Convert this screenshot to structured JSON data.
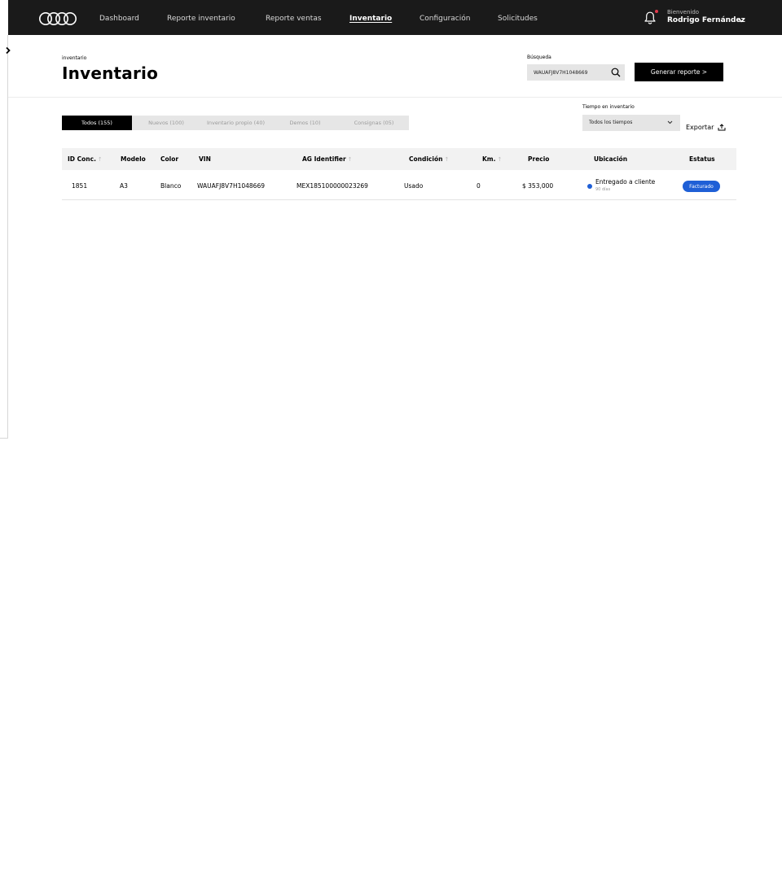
{
  "nav": {
    "items": [
      "Dashboard",
      "Reporte inventario",
      "Reporte ventas",
      "Inventario",
      "Configuración",
      "Solicitudes"
    ],
    "active": "Inventario",
    "welcome": "Bienvenido",
    "user_name": "Rodrigo Fernández"
  },
  "header": {
    "breadcrumb": "inventario",
    "title": "Inventario",
    "search_label": "Búsqueda",
    "search_value": "WAUAFJ8V7H1048669",
    "generate_button": "Generar reporte >"
  },
  "filters": {
    "tabs": [
      "Todos (155)",
      "Nuevos (100)",
      "Inventario propio (40)",
      "Demos  (10)",
      "Consignas  (05)"
    ],
    "active_tab": "Todos (155)",
    "time_label": "Tiempo en inventario",
    "time_value": "Todos los tiempos",
    "export_label": "Exportar"
  },
  "table": {
    "columns": [
      "ID Conc.",
      "Modelo",
      "Color",
      "VIN",
      "AG Identifier",
      "Condición",
      "Km.",
      "Precio",
      "Ubicación",
      "Estatus"
    ],
    "rows": [
      {
        "id": "1851",
        "modelo": "A3",
        "color": "Blanco",
        "vin": "WAUAFJ8V7H1048669",
        "ag_identifier": "MEX185100000023269",
        "condicion": "Usado",
        "km": "0",
        "precio": "$ 353,000",
        "ubicacion": "Entregado a cliente",
        "ubicacion_sub": "90 días",
        "estatus": "Facturado"
      }
    ]
  },
  "colors": {
    "accent": "#1f5fd6",
    "nav_bg": "#1a1a1a",
    "notification": "#e2394b"
  }
}
